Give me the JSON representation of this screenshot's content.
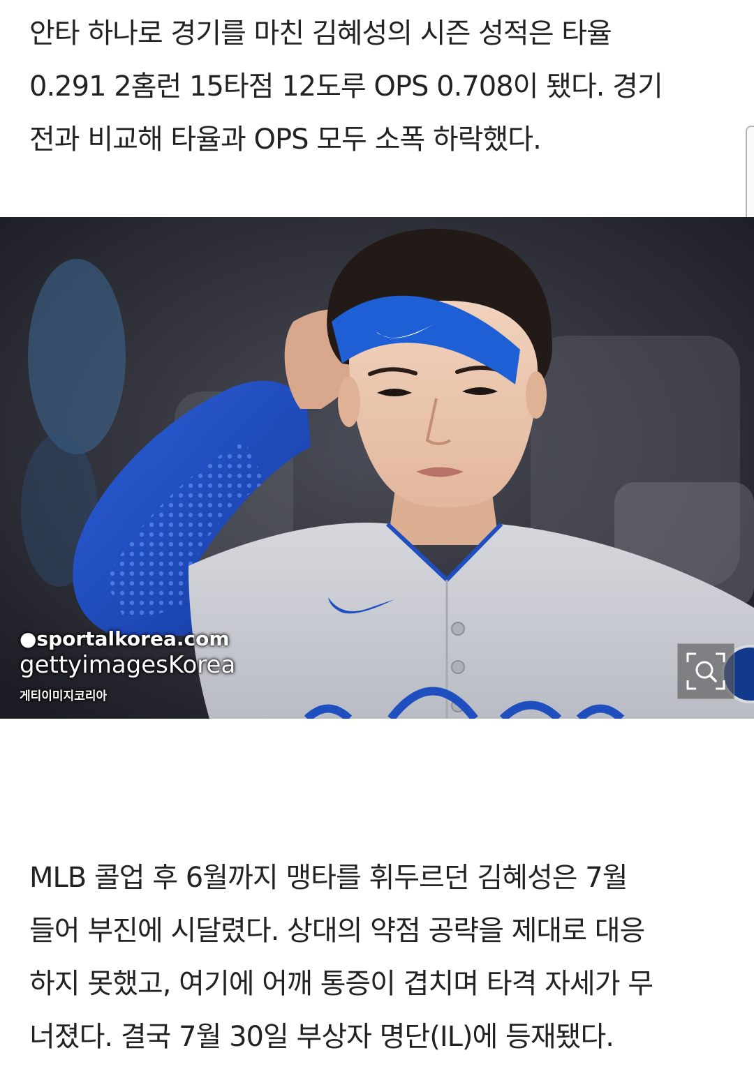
{
  "article": {
    "paragraph_1": [
      "안타 하나로 경기를 마친 김혜성의 시즌 성적은 타율",
      "0.291 2홈런 15타점 12도루 OPS 0.708이 됐다. 경기",
      "전과 비교해 타율과 OPS 모두 소폭 하락했다."
    ],
    "paragraph_2": [
      "MLB 콜업 후 6월까지 맹타를 휘두르던 김혜성은 7월",
      "들어 부진에 시달렸다. 상대의 약점 공략을 제대로 대응",
      "하지 못했고, 여기에 어깨 통증이 겹치며 타격 자세가 무",
      "너졌다. 결국 7월 30일 부상자 명단(IL)에 등재됐다."
    ]
  },
  "photo": {
    "watermark_line_1": "●sportalkorea.com",
    "watermark_line_2": "gettyimagesKorea",
    "watermark_line_3": "게티이미지코리아",
    "zoom_icon": "magnify-expand-icon"
  },
  "colors": {
    "text": "#222222",
    "headband": "#1f5fd6",
    "sleeve": "#2e5fd8",
    "jersey": "#c9ccd2"
  }
}
